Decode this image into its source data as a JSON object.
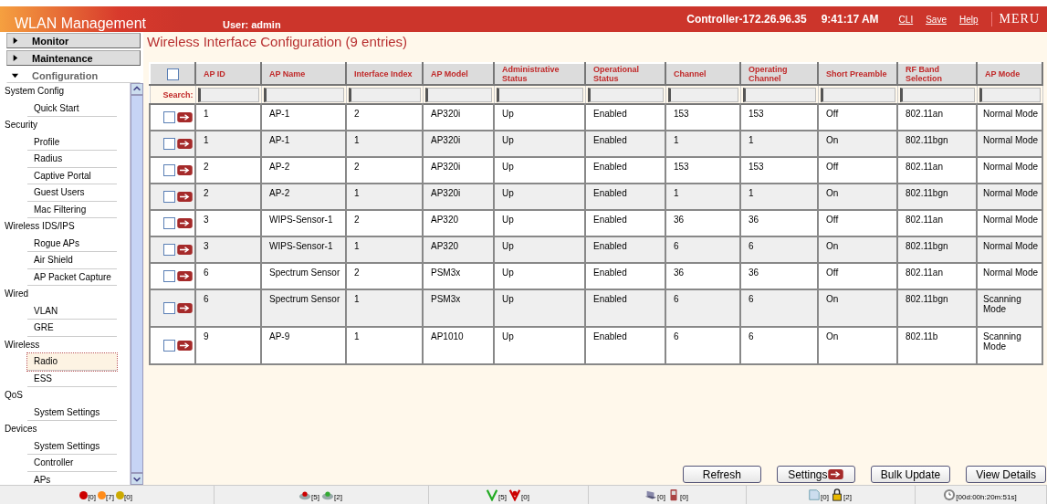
{
  "header": {
    "title": "WLAN Management",
    "user": "User: admin",
    "controller": "Controller-172.26.96.35",
    "time": "9:41:17 AM",
    "links": [
      "CLI",
      "Save",
      "Help"
    ],
    "logo": "MERU"
  },
  "sidebar": {
    "menus": [
      {
        "label": "Monitor",
        "expanded": false
      },
      {
        "label": "Maintenance",
        "expanded": false
      },
      {
        "label": "Configuration",
        "expanded": true
      }
    ],
    "groups": [
      {
        "label": "System Config",
        "children": [
          {
            "label": "Quick Start",
            "selected": false
          }
        ]
      },
      {
        "label": "Security",
        "children": [
          {
            "label": "Profile",
            "selected": false
          },
          {
            "label": "Radius",
            "selected": false
          },
          {
            "label": "Captive Portal",
            "selected": false
          },
          {
            "label": "Guest Users",
            "selected": false
          },
          {
            "label": "Mac Filtering",
            "selected": false
          }
        ]
      },
      {
        "label": "Wireless IDS/IPS",
        "children": [
          {
            "label": "Rogue APs",
            "selected": false
          },
          {
            "label": "Air Shield",
            "selected": false
          },
          {
            "label": "AP Packet Capture",
            "selected": false
          }
        ]
      },
      {
        "label": "Wired",
        "children": [
          {
            "label": "VLAN",
            "selected": false
          },
          {
            "label": "GRE",
            "selected": false
          }
        ]
      },
      {
        "label": "Wireless",
        "children": [
          {
            "label": "Radio",
            "selected": true
          },
          {
            "label": "ESS",
            "selected": false
          }
        ]
      },
      {
        "label": "QoS",
        "children": [
          {
            "label": "System Settings",
            "selected": false
          }
        ]
      },
      {
        "label": "Devices",
        "children": [
          {
            "label": "System Settings",
            "selected": false
          },
          {
            "label": "Controller",
            "selected": false
          },
          {
            "label": "APs",
            "selected": false
          }
        ]
      }
    ]
  },
  "page_title": "Wireless Interface Configuration (9 entries)",
  "table": {
    "select_all": {
      "checked": false
    },
    "search_label": "Search:",
    "columns": [
      "AP ID",
      "AP Name",
      "Interface Index",
      "AP Model",
      "Administrative Status",
      "Operational Status",
      "Channel",
      "Operating Channel",
      "Short Preamble",
      "RF Band Selection",
      "AP Mode"
    ],
    "rows": [
      {
        "checked": false,
        "cells": [
          "1",
          "AP-1",
          "2",
          "AP320i",
          "Up",
          "Enabled",
          "153",
          "153",
          "Off",
          "802.11an",
          "Normal Mode"
        ]
      },
      {
        "checked": false,
        "cells": [
          "1",
          "AP-1",
          "1",
          "AP320i",
          "Up",
          "Enabled",
          "1",
          "1",
          "On",
          "802.11bgn",
          "Normal Mode"
        ]
      },
      {
        "checked": false,
        "cells": [
          "2",
          "AP-2",
          "2",
          "AP320i",
          "Up",
          "Enabled",
          "153",
          "153",
          "Off",
          "802.11an",
          "Normal Mode"
        ]
      },
      {
        "checked": false,
        "cells": [
          "2",
          "AP-2",
          "1",
          "AP320i",
          "Up",
          "Enabled",
          "1",
          "1",
          "On",
          "802.11bgn",
          "Normal Mode"
        ]
      },
      {
        "checked": false,
        "cells": [
          "3",
          "WIPS-Sensor-1",
          "2",
          "AP320",
          "Up",
          "Enabled",
          "36",
          "36",
          "Off",
          "802.11an",
          "Normal Mode"
        ]
      },
      {
        "checked": false,
        "cells": [
          "3",
          "WIPS-Sensor-1",
          "1",
          "AP320",
          "Up",
          "Enabled",
          "6",
          "6",
          "On",
          "802.11bgn",
          "Normal Mode"
        ]
      },
      {
        "checked": false,
        "cells": [
          "6",
          "Spectrum Sensor",
          "2",
          "PSM3x",
          "Up",
          "Enabled",
          "36",
          "36",
          "Off",
          "802.11an",
          "Normal Mode"
        ]
      },
      {
        "checked": false,
        "cells": [
          "6",
          "Spectrum Sensor",
          "1",
          "PSM3x",
          "Up",
          "Enabled",
          "6",
          "6",
          "On",
          "802.11bgn",
          "Scanning Mode"
        ]
      },
      {
        "checked": false,
        "cells": [
          "9",
          "AP-9",
          "1",
          "AP1010",
          "Up",
          "Enabled",
          "6",
          "6",
          "On",
          "802.11b",
          "Scanning Mode"
        ]
      }
    ]
  },
  "buttons": [
    {
      "label": "Refresh",
      "kind": "plain"
    },
    {
      "label": "Settings",
      "kind": "arrow"
    },
    {
      "label": "Bulk Update",
      "kind": "plain"
    },
    {
      "label": "View Details",
      "kind": "plain"
    }
  ],
  "status_bar": [
    {
      "items": [
        {
          "kind": "dot",
          "color": "#cc0000",
          "count": "[0]"
        },
        {
          "kind": "dot",
          "color": "#ff8c1a",
          "count": "[7]"
        },
        {
          "kind": "dot",
          "color": "#ccaa00",
          "count": "[0]"
        }
      ]
    },
    {
      "items": [
        {
          "kind": "ap-down",
          "count": "[5]"
        },
        {
          "kind": "ap-up",
          "count": "[2]"
        }
      ]
    },
    {
      "items": [
        {
          "kind": "shield-ok",
          "count": "[5]"
        },
        {
          "kind": "shield-bad",
          "count": "[0]"
        }
      ]
    },
    {
      "items": [
        {
          "kind": "laptop",
          "count": "[0]"
        },
        {
          "kind": "phone",
          "count": "[0]"
        }
      ]
    },
    {
      "items": [
        {
          "kind": "doc",
          "count": "[0]"
        },
        {
          "kind": "lock",
          "count": "[2]"
        }
      ]
    },
    {
      "items": [
        {
          "kind": "clock",
          "count": "[00d:00h:20m:51s]"
        }
      ]
    }
  ]
}
